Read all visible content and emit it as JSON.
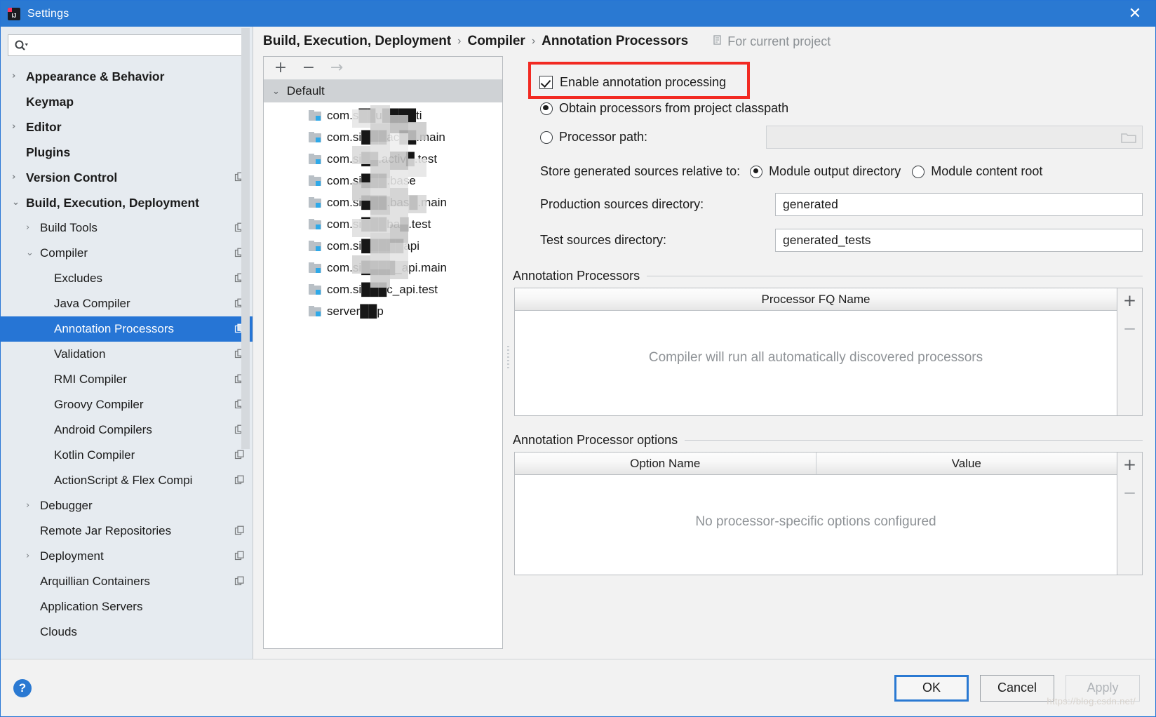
{
  "window": {
    "title": "Settings",
    "logo_icon": "intellij-idea-logo",
    "close_icon": "close-icon"
  },
  "search": {
    "value": "",
    "placeholder": "",
    "icon": "search-icon",
    "dropdown_icon": "chevron-down-icon"
  },
  "sidebar": {
    "items": [
      {
        "label": "Appearance & Behavior",
        "level": 0,
        "arrow": "›",
        "copy": false,
        "selected": false
      },
      {
        "label": "Keymap",
        "level": 0,
        "arrow": "",
        "copy": false,
        "selected": false
      },
      {
        "label": "Editor",
        "level": 0,
        "arrow": "›",
        "copy": false,
        "selected": false
      },
      {
        "label": "Plugins",
        "level": 0,
        "arrow": "",
        "copy": false,
        "selected": false
      },
      {
        "label": "Version Control",
        "level": 0,
        "arrow": "›",
        "copy": true,
        "selected": false
      },
      {
        "label": "Build, Execution, Deployment",
        "level": 0,
        "arrow": "⌄",
        "copy": false,
        "selected": false
      },
      {
        "label": "Build Tools",
        "level": 1,
        "arrow": "›",
        "copy": true,
        "selected": false
      },
      {
        "label": "Compiler",
        "level": 1,
        "arrow": "⌄",
        "copy": true,
        "selected": false
      },
      {
        "label": "Excludes",
        "level": 2,
        "arrow": "",
        "copy": true,
        "selected": false
      },
      {
        "label": "Java Compiler",
        "level": 2,
        "arrow": "",
        "copy": true,
        "selected": false
      },
      {
        "label": "Annotation Processors",
        "level": 2,
        "arrow": "",
        "copy": true,
        "selected": true
      },
      {
        "label": "Validation",
        "level": 2,
        "arrow": "",
        "copy": true,
        "selected": false
      },
      {
        "label": "RMI Compiler",
        "level": 2,
        "arrow": "",
        "copy": true,
        "selected": false
      },
      {
        "label": "Groovy Compiler",
        "level": 2,
        "arrow": "",
        "copy": true,
        "selected": false
      },
      {
        "label": "Android Compilers",
        "level": 2,
        "arrow": "",
        "copy": true,
        "selected": false
      },
      {
        "label": "Kotlin Compiler",
        "level": 2,
        "arrow": "",
        "copy": true,
        "selected": false
      },
      {
        "label": "ActionScript & Flex Compi",
        "level": 2,
        "arrow": "",
        "copy": true,
        "selected": false
      },
      {
        "label": "Debugger",
        "level": 1,
        "arrow": "›",
        "copy": false,
        "selected": false
      },
      {
        "label": "Remote Jar Repositories",
        "level": 1,
        "arrow": "",
        "copy": true,
        "selected": false
      },
      {
        "label": "Deployment",
        "level": 1,
        "arrow": "›",
        "copy": true,
        "selected": false
      },
      {
        "label": "Arquillian Containers",
        "level": 1,
        "arrow": "",
        "copy": true,
        "selected": false
      },
      {
        "label": "Application Servers",
        "level": 1,
        "arrow": "",
        "copy": false,
        "selected": false
      },
      {
        "label": "Clouds",
        "level": 1,
        "arrow": "",
        "copy": false,
        "selected": false
      }
    ]
  },
  "breadcrumb": {
    "part1": "Build, Execution, Deployment",
    "sep": "›",
    "part2": "Compiler",
    "part3": "Annotation Processors",
    "scope_label": "For current project",
    "scope_icon": "project-scope-icon"
  },
  "module_pane": {
    "toolbar": {
      "add_icon": "plus-icon",
      "remove_icon": "minus-icon",
      "move_icon": "arrow-right-icon"
    },
    "group_label": "Default",
    "group_arrow": "⌄",
    "modules": [
      "com.s██u████ti",
      "com.si███ac██.main",
      "com.si██.activ█.test",
      "com.si███.base",
      "com.si███.bas█.main",
      "com.si███ba█.test",
      "com.si█████api",
      "com.si████_api.main",
      "com.si███c_api.test",
      "server██p"
    ]
  },
  "settings": {
    "enable_processing": {
      "label": "Enable annotation processing",
      "checked": true
    },
    "source_mode": {
      "option_classpath": "Obtain processors from project classpath",
      "option_path": "Processor path:",
      "selected": "classpath"
    },
    "processor_path": {
      "value": "",
      "enabled": false,
      "browse_icon": "folder-open-icon"
    },
    "store_relative": {
      "label": "Store generated sources relative to:",
      "option_output": "Module output directory",
      "option_content": "Module content root",
      "selected": "output"
    },
    "production_sources": {
      "label": "Production sources directory:",
      "value": "generated"
    },
    "test_sources": {
      "label": "Test sources directory:",
      "value": "generated_tests"
    },
    "processors_group": {
      "title": "Annotation Processors",
      "column_header": "Processor FQ Name",
      "empty_message": "Compiler will run all automatically discovered processors",
      "add_icon": "plus-icon",
      "remove_icon": "minus-icon"
    },
    "options_group": {
      "title": "Annotation Processor options",
      "column_name": "Option Name",
      "column_value": "Value",
      "empty_message": "No processor-specific options configured",
      "add_icon": "plus-icon",
      "remove_icon": "minus-icon"
    }
  },
  "footer": {
    "help_icon": "?",
    "ok": "OK",
    "cancel": "Cancel",
    "apply": "Apply",
    "watermark": "https://blog.csdn.net/"
  },
  "colors": {
    "titlebar": "#2a79d2",
    "accent": "#2675d5",
    "sidebar_bg": "#e6ebf0",
    "highlight_box": "#f22a22",
    "panel_bg": "#f2f2f2"
  }
}
